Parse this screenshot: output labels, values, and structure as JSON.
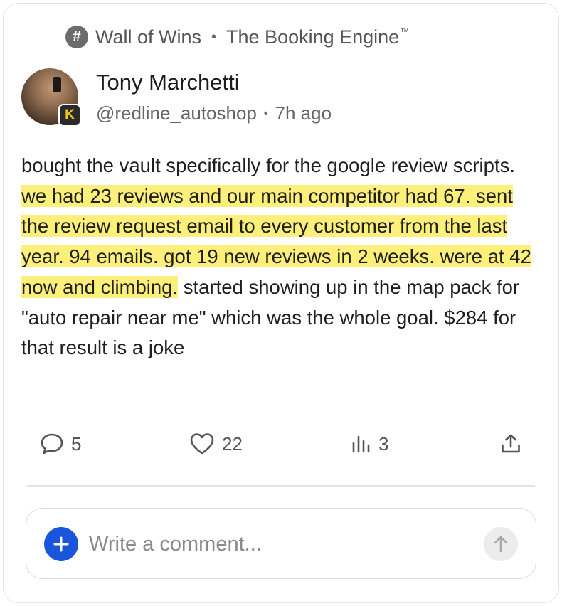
{
  "community": {
    "name": "Wall of Wins",
    "space": "The Booking Engine",
    "space_mark": "™"
  },
  "author": {
    "name": "Tony Marchetti",
    "handle": "@redline_autoshop",
    "time": "7h ago",
    "badge_letter": "K"
  },
  "post": {
    "text_1": "bought the vault specifically for the google review scripts. ",
    "highlight": "we had 23 reviews and our main competitor had 67. sent the review request email to every customer from the last year. 94 emails. got 19 new reviews in 2 weeks. were at 42 now and climbing.",
    "text_2": " started showing up in the map pack for \"auto repair near me\" which was the whole goal. $284 for that result is a joke",
    "highlight_color": "#fdf07a"
  },
  "actions": {
    "comments": "5",
    "likes": "22",
    "views": "3"
  },
  "composer": {
    "placeholder": "Write a comment...",
    "plus_color": "#1a56db"
  },
  "icons": {
    "community": "hash-icon",
    "comment": "comment-bubble-icon",
    "like": "heart-icon",
    "views": "bar-chart-icon",
    "share": "share-upload-icon",
    "plus": "plus-icon",
    "send": "arrow-up-icon"
  }
}
